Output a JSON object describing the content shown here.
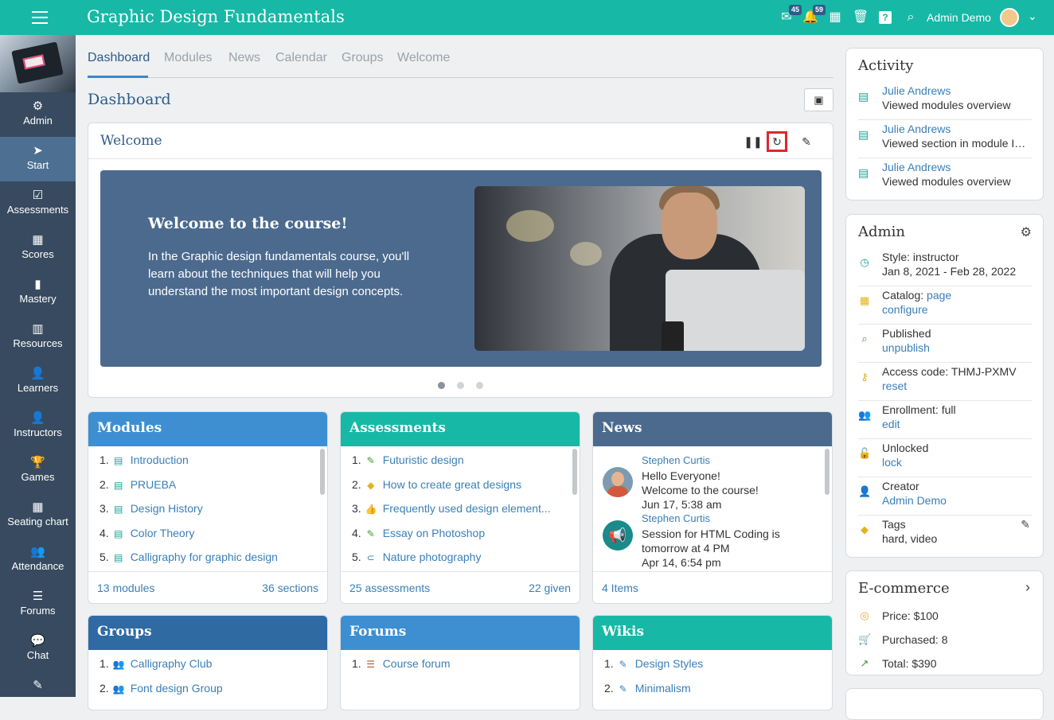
{
  "app": {
    "title": "Graphic Design Fundamentals",
    "mail_badge": "45",
    "alerts_badge": "59",
    "user_name": "Admin Demo"
  },
  "sidebar": {
    "items": [
      {
        "label": "Admin",
        "icon": "gear-icon",
        "glyph": "⚙"
      },
      {
        "label": "Start",
        "icon": "navigation-arrow-icon",
        "glyph": "➤"
      },
      {
        "label": "Assessments",
        "icon": "checkbox-icon",
        "glyph": "☑"
      },
      {
        "label": "Scores",
        "icon": "gradebook-icon",
        "glyph": "▦"
      },
      {
        "label": "Mastery",
        "icon": "bar-chart-icon",
        "glyph": "▮"
      },
      {
        "label": "Resources",
        "icon": "books-icon",
        "glyph": "▥"
      },
      {
        "label": "Learners",
        "icon": "user-icon",
        "glyph": "👤"
      },
      {
        "label": "Instructors",
        "icon": "instructor-icon",
        "glyph": "👤"
      },
      {
        "label": "Games",
        "icon": "trophy-icon",
        "glyph": "🏆"
      },
      {
        "label": "Seating chart",
        "icon": "seating-grid-icon",
        "glyph": "▦"
      },
      {
        "label": "Attendance",
        "icon": "group-icon",
        "glyph": "👥"
      },
      {
        "label": "Forums",
        "icon": "list-icon",
        "glyph": "☰"
      },
      {
        "label": "Chat",
        "icon": "chat-bubble-icon",
        "glyph": "💬"
      },
      {
        "label": "",
        "icon": "edit-note-icon",
        "glyph": "✎"
      }
    ]
  },
  "tabs": [
    "Dashboard",
    "Modules",
    "News",
    "Calendar",
    "Groups",
    "Welcome"
  ],
  "page_title": "Dashboard",
  "welcome": {
    "title": "Welcome",
    "slide_heading": "Welcome to the course!",
    "slide_text": "In the Graphic design fundamentals course, you'll learn about the techniques that will help you understand the most important design concepts.",
    "slide_count": 3,
    "active_slide": 1
  },
  "modules": {
    "title": "Modules",
    "color": "#3d8fd1",
    "items": [
      "Introduction",
      "PRUEBA",
      "Design History",
      "Color Theory",
      "Calligraphy for graphic design"
    ],
    "footer_left": "13 modules",
    "footer_right": "36 sections"
  },
  "assessments": {
    "title": "Assessments",
    "color": "#17b8a6",
    "items": [
      {
        "label": "Futuristic design",
        "icon": "pencil-icon",
        "glyph": "✎",
        "color": "#3f9a2f"
      },
      {
        "label": "How to create great designs",
        "icon": "package-icon",
        "glyph": "◆",
        "color": "#e2b21c"
      },
      {
        "label": "Frequently used design element...",
        "icon": "thumbs-up-icon",
        "glyph": "👍",
        "color": "#3f9a2f"
      },
      {
        "label": "Essay on Photoshop",
        "icon": "pencil-icon",
        "glyph": "✎",
        "color": "#3f9a2f"
      },
      {
        "label": "Nature photography",
        "icon": "paperclip-icon",
        "glyph": "⊂",
        "color": "#3a7fb8"
      }
    ],
    "footer_left": "25 assessments",
    "footer_right": "22 given"
  },
  "news": {
    "title": "News",
    "color": "#4b6a8e",
    "items": [
      {
        "author": "Stephen Curtis",
        "lines": [
          "Hello Everyone!",
          "Welcome to the course!",
          "Jun 17, 5:38 am"
        ]
      },
      {
        "author": "Stephen Curtis",
        "lines": [
          "Session for HTML Coding is",
          "tomorrow at 4 PM",
          "Apr 14, 6:54 pm"
        ]
      }
    ],
    "footer_left": "4 Items"
  },
  "groups": {
    "title": "Groups",
    "color": "#2f6aa3",
    "items": [
      "Calligraphy Club",
      "Font design Group"
    ]
  },
  "forums": {
    "title": "Forums",
    "color": "#3d8fd1",
    "items": [
      "Course forum"
    ]
  },
  "wikis": {
    "title": "Wikis",
    "color": "#17b8a6",
    "items": [
      "Design Styles",
      "Minimalism"
    ]
  },
  "activity": {
    "title": "Activity",
    "items": [
      {
        "name": "Julie Andrews",
        "desc": "Viewed modules overview"
      },
      {
        "name": "Julie Andrews",
        "desc": "Viewed section in module Int..."
      },
      {
        "name": "Julie Andrews",
        "desc": "Viewed modules overview"
      }
    ]
  },
  "admin": {
    "title": "Admin",
    "rows": [
      {
        "l1": "Style: instructor",
        "l2": "Jan 8, 2021 - Feb 28, 2022",
        "link": false,
        "icon": "clock-icon",
        "glyph": "◷",
        "color": "#17a398"
      },
      {
        "l1": "Catalog: ",
        "l1_link": "page",
        "l2": "configure",
        "link": true,
        "icon": "catalog-grid-icon",
        "glyph": "▦",
        "color": "#e2b21c"
      },
      {
        "l1": "Published",
        "l2": "unpublish",
        "link": true,
        "icon": "search-icon",
        "glyph": "⌕",
        "color": "#3f9a2f"
      },
      {
        "l1": "Access code: THMJ-PXMV",
        "l2": "reset",
        "link": true,
        "icon": "key-icon",
        "glyph": "⚷",
        "color": "#e2b21c"
      },
      {
        "l1": "Enrollment: full",
        "l2": "edit",
        "link": true,
        "icon": "group-icon",
        "glyph": "👥",
        "color": "#3a7fb8"
      },
      {
        "l1": "Unlocked",
        "l2": "lock",
        "link": true,
        "icon": "unlock-icon",
        "glyph": "🔓",
        "color": "#3f9a2f"
      },
      {
        "l1": "Creator",
        "l2": "Admin Demo",
        "link": true,
        "icon": "user-icon",
        "glyph": "👤",
        "color": "#17a398"
      },
      {
        "l1": "Tags",
        "l2": "hard, video",
        "link": false,
        "icon": "tag-icon",
        "glyph": "◆",
        "color": "#e2b21c"
      }
    ]
  },
  "ecommerce": {
    "title": "E-commerce",
    "rows": [
      {
        "label": "Price: $100",
        "icon": "coins-icon",
        "glyph": "◎",
        "color": "#e2b21c"
      },
      {
        "label": "Purchased: 8",
        "icon": "cart-icon",
        "glyph": "🛒",
        "color": "#e2b21c"
      },
      {
        "label": "Total: $390",
        "icon": "trend-chart-icon",
        "glyph": "↗",
        "color": "#3f9a2f"
      }
    ]
  }
}
